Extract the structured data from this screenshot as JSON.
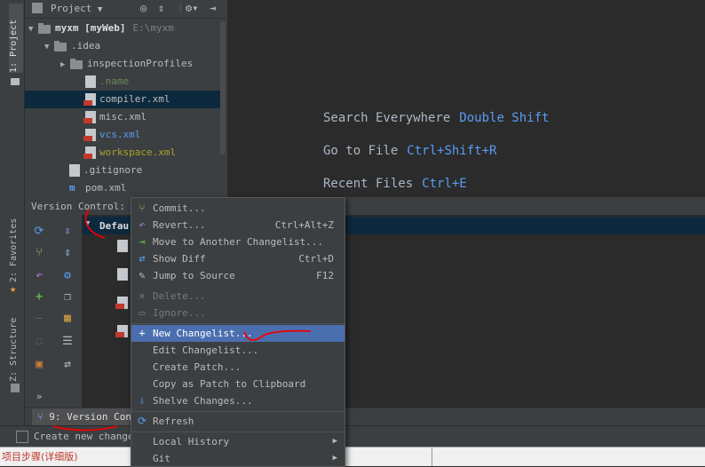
{
  "left_tools": {
    "project": "1: Project",
    "favorites": "2: Favorites",
    "structure": "Z: Structure"
  },
  "project": {
    "title": "Project",
    "tree": [
      {
        "label": "myxm [myWeb]",
        "hint": "E:\\myxm",
        "indent": 0,
        "expanded": true,
        "type": "module"
      },
      {
        "label": ".idea",
        "indent": 1,
        "expanded": true,
        "type": "folder"
      },
      {
        "label": "inspectionProfiles",
        "indent": 2,
        "expanded": false,
        "type": "folder"
      },
      {
        "label": ".name",
        "indent": 3,
        "type": "file",
        "color": "#6a8759"
      },
      {
        "label": "compiler.xml",
        "indent": 3,
        "type": "xml",
        "selected": true
      },
      {
        "label": "misc.xml",
        "indent": 3,
        "type": "xml"
      },
      {
        "label": "vcs.xml",
        "indent": 3,
        "type": "xml",
        "color": "#589df6"
      },
      {
        "label": "workspace.xml",
        "indent": 3,
        "type": "xml",
        "color": "#a7a328"
      },
      {
        "label": ".gitignore",
        "indent": 2,
        "type": "file"
      },
      {
        "label": "pom.xml",
        "indent": 2,
        "type": "maven"
      }
    ]
  },
  "editor": {
    "hints": [
      {
        "text": "Search Everywhere",
        "key": "Double Shift"
      },
      {
        "text": "Go to File",
        "key": "Ctrl+Shift+R"
      },
      {
        "text": "Recent Files",
        "key": "Ctrl+E"
      }
    ]
  },
  "version_control": {
    "title": "Version Control:",
    "row_label": "Defau"
  },
  "bottom_tab": {
    "label": "9: Version Cont"
  },
  "status": {
    "text": "Create new changel"
  },
  "context_menu": {
    "items": [
      {
        "label": "Commit...",
        "shortcut": "",
        "icon": "commit-icon",
        "disabled": false
      },
      {
        "label": "Revert...",
        "shortcut": "Ctrl+Alt+Z",
        "icon": "revert-icon",
        "disabled": false
      },
      {
        "label": "Move to Another Changelist...",
        "shortcut": "",
        "icon": "move-changelist-icon",
        "disabled": false
      },
      {
        "label": "Show Diff",
        "shortcut": "Ctrl+D",
        "icon": "diff-icon",
        "disabled": false
      },
      {
        "label": "Jump to Source",
        "shortcut": "F12",
        "icon": "jump-source-icon",
        "disabled": false
      },
      {
        "label": "Delete...",
        "shortcut": "",
        "icon": "delete-icon",
        "disabled": true
      },
      {
        "label": "Ignore...",
        "shortcut": "",
        "icon": "ignore-icon",
        "disabled": true
      },
      {
        "label": "New Changelist...",
        "shortcut": "",
        "icon": "plus-icon",
        "disabled": false,
        "highlighted": true
      },
      {
        "label": "Edit Changelist...",
        "shortcut": "",
        "icon": "",
        "disabled": false
      },
      {
        "label": "Create Patch...",
        "shortcut": "",
        "icon": "",
        "disabled": false
      },
      {
        "label": "Copy as Patch to Clipboard",
        "shortcut": "",
        "icon": "",
        "disabled": false
      },
      {
        "label": "Shelve Changes...",
        "shortcut": "",
        "icon": "shelve-icon",
        "disabled": false
      },
      {
        "label": "Refresh",
        "shortcut": "",
        "icon": "refresh-icon",
        "disabled": false
      },
      {
        "label": "Local History",
        "shortcut": "",
        "icon": "",
        "disabled": false,
        "submenu": true
      },
      {
        "label": "Git",
        "shortcut": "",
        "icon": "",
        "disabled": false,
        "submenu": true
      }
    ]
  },
  "browser_strip": {
    "text": "项目步骤(详细版)"
  },
  "colors": {
    "accent": "#4b6eaf",
    "selection": "#0d293e",
    "panel": "#3c3f41",
    "editor": "#2b2b2b",
    "link": "#589df6"
  }
}
